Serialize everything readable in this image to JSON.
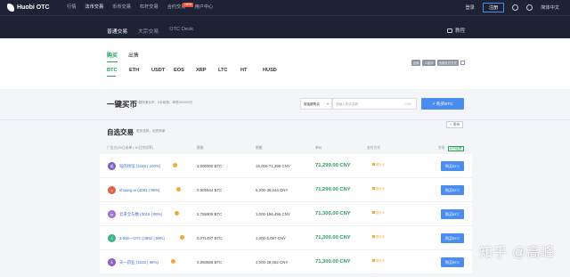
{
  "topbar": {
    "logo": "Huobi OTC",
    "nav": [
      {
        "label": "行情"
      },
      {
        "label": "法币交易"
      },
      {
        "label": "币币交易"
      },
      {
        "label": "杠杆交易"
      },
      {
        "label": "合约交易",
        "badge": "NEW"
      },
      {
        "label": "用户中心"
      }
    ],
    "login": "登录",
    "register": "注册",
    "language": "简体中文"
  },
  "subbar": {
    "tabs": [
      "普通交易",
      "大宗交易",
      "OTC Desk"
    ],
    "tutorial": "教程"
  },
  "trade": {
    "buy": "购买",
    "sell": "出售",
    "coins": [
      "BTC",
      "ETH",
      "USDT",
      "EOS",
      "XRP",
      "LTC",
      "HT",
      "HUSD"
    ],
    "filters": [
      "全部",
      "人民币",
      "全部支付方式"
    ]
  },
  "quick": {
    "title": "一键买币",
    "desc": "小额快速买币，0手续费，单笔500000万",
    "select_value": "按金额购买",
    "input_placeholder": "请输入购买金额",
    "input_unit": "CNY",
    "button": "⚡ 购买BTC"
  },
  "list": {
    "publish": "+ 发布",
    "title": "自选交易",
    "subtitle": "更多选择，优质商家",
    "headers": {
      "merchant": "广告方(30日成单 | 30日完成率)",
      "qty": "数量",
      "limit": "限额",
      "price": "单价",
      "pay": "支付方式",
      "action": "交易",
      "fee": "0手续费"
    },
    "rows": [
      {
        "avatar": "韬",
        "name": "韬的场馆 (4346 | 100%)",
        "qty": "1.000000 BTC",
        "limit": "15,000-71,298 CNY",
        "price": "71,299.00 CNY",
        "pay": "银行卡",
        "button": "购买BTC",
        "color": "#7a5cc4"
      },
      {
        "avatar": "s",
        "name": "shuang-xi (4081 | 99%)",
        "qty": "0.505544 BTC",
        "limit": "5,000-36,044 CNY",
        "price": "71,299.00 CNY",
        "pay": "银行卡",
        "button": "购买BTC",
        "color": "#e0614a"
      },
      {
        "avatar": "云",
        "name": "云来全与数 (3019 | 99%)",
        "qty": "2.755909 BTC",
        "limit": "1,000-196,496 CNY",
        "price": "71,300.00 CNY",
        "pay": "银行卡",
        "button": "购买BTC",
        "color": "#9a6fd0"
      },
      {
        "avatar": "3",
        "name": "3.800—OTC (3962 | 99%)",
        "qty": "0.071497 BTC",
        "limit": "1,000-5,097 CNY",
        "price": "71,300.00 CNY",
        "pay": "银行卡",
        "button": "购买BTC",
        "color": "#3fb38a"
      },
      {
        "avatar": "天",
        "name": "天一药业 (1632 | 98%)",
        "qty": "0.393586 BTC",
        "limit": "1,000-28,062 CNY",
        "price": "71,300.00 CNY",
        "pay": "银行卡",
        "button": "购买BTC",
        "color": "#8a5cc4"
      }
    ]
  },
  "watermark": "知乎 @高峰"
}
